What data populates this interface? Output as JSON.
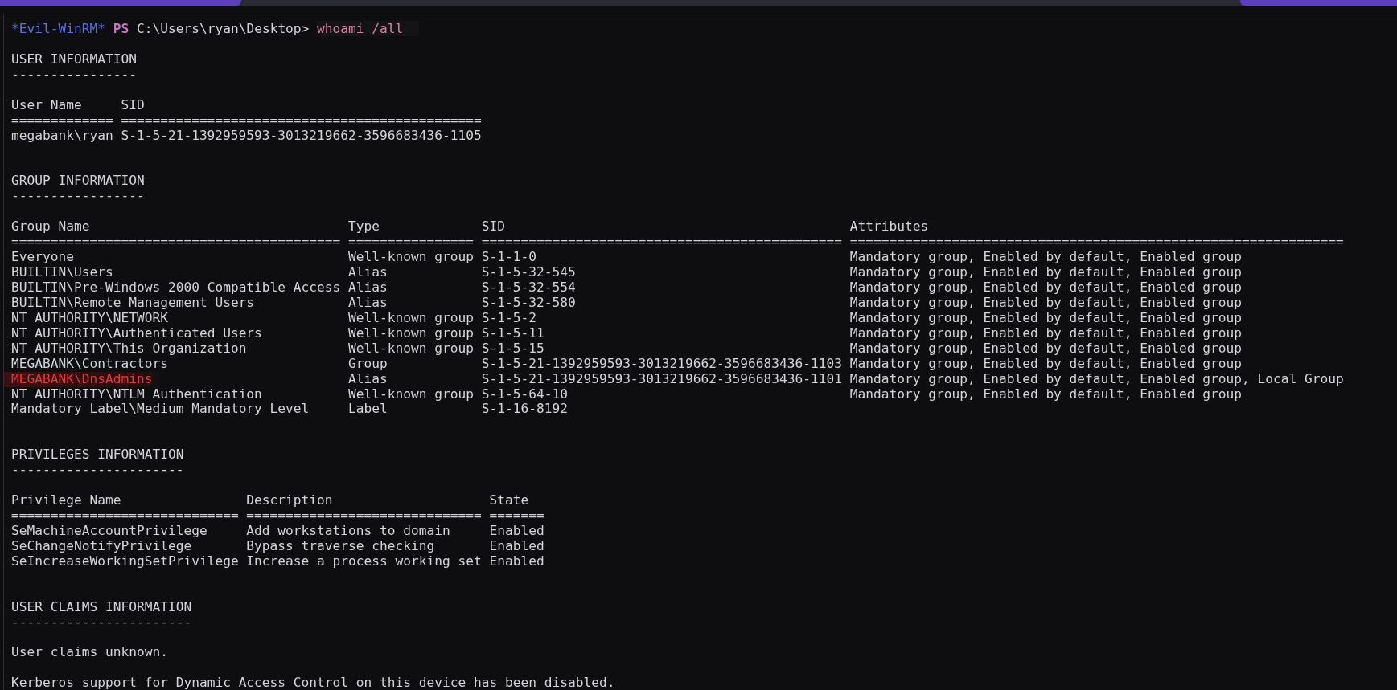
{
  "prompt": {
    "shell": "*Evil-WinRM*",
    "ps": "PS",
    "path": "C:\\Users\\ryan\\Desktop>",
    "command": "whoami /all"
  },
  "blocks": [
    {
      "kind": "blank"
    },
    {
      "kind": "heading",
      "title": "USER INFORMATION",
      "rule": "----------------"
    },
    {
      "kind": "blank"
    },
    {
      "kind": "table",
      "columns": [
        {
          "label": "User Name",
          "rule": "============="
        },
        {
          "label": "SID",
          "rule": "=============================================="
        }
      ],
      "rows": [
        {
          "cells": [
            "megabank\\ryan",
            "S-1-5-21-1392959593-3013219662-3596683436-1105"
          ],
          "highlighted": false
        }
      ]
    },
    {
      "kind": "blank"
    },
    {
      "kind": "blank"
    },
    {
      "kind": "heading",
      "title": "GROUP INFORMATION",
      "rule": "-----------------"
    },
    {
      "kind": "blank"
    },
    {
      "kind": "table",
      "columns": [
        {
          "label": "Group Name",
          "rule": "=========================================="
        },
        {
          "label": "Type",
          "rule": "================"
        },
        {
          "label": "SID",
          "rule": "=============================================="
        },
        {
          "label": "Attributes",
          "rule": "==============================================================="
        }
      ],
      "rows": [
        {
          "cells": [
            "Everyone",
            "Well-known group",
            "S-1-1-0",
            "Mandatory group, Enabled by default, Enabled group"
          ],
          "highlighted": false
        },
        {
          "cells": [
            "BUILTIN\\Users",
            "Alias",
            "S-1-5-32-545",
            "Mandatory group, Enabled by default, Enabled group"
          ],
          "highlighted": false
        },
        {
          "cells": [
            "BUILTIN\\Pre-Windows 2000 Compatible Access",
            "Alias",
            "S-1-5-32-554",
            "Mandatory group, Enabled by default, Enabled group"
          ],
          "highlighted": false
        },
        {
          "cells": [
            "BUILTIN\\Remote Management Users",
            "Alias",
            "S-1-5-32-580",
            "Mandatory group, Enabled by default, Enabled group"
          ],
          "highlighted": false
        },
        {
          "cells": [
            "NT AUTHORITY\\NETWORK",
            "Well-known group",
            "S-1-5-2",
            "Mandatory group, Enabled by default, Enabled group"
          ],
          "highlighted": false
        },
        {
          "cells": [
            "NT AUTHORITY\\Authenticated Users",
            "Well-known group",
            "S-1-5-11",
            "Mandatory group, Enabled by default, Enabled group"
          ],
          "highlighted": false
        },
        {
          "cells": [
            "NT AUTHORITY\\This Organization",
            "Well-known group",
            "S-1-5-15",
            "Mandatory group, Enabled by default, Enabled group"
          ],
          "highlighted": false
        },
        {
          "cells": [
            "MEGABANK\\Contractors",
            "Group",
            "S-1-5-21-1392959593-3013219662-3596683436-1103",
            "Mandatory group, Enabled by default, Enabled group"
          ],
          "highlighted": false
        },
        {
          "cells": [
            "MEGABANK\\DnsAdmins",
            "Alias",
            "S-1-5-21-1392959593-3013219662-3596683436-1101",
            "Mandatory group, Enabled by default, Enabled group, Local Group"
          ],
          "highlighted": true
        },
        {
          "cells": [
            "NT AUTHORITY\\NTLM Authentication",
            "Well-known group",
            "S-1-5-64-10",
            "Mandatory group, Enabled by default, Enabled group"
          ],
          "highlighted": false
        },
        {
          "cells": [
            "Mandatory Label\\Medium Mandatory Level",
            "Label",
            "S-1-16-8192"
          ],
          "highlighted": false
        }
      ]
    },
    {
      "kind": "blank"
    },
    {
      "kind": "blank"
    },
    {
      "kind": "heading",
      "title": "PRIVILEGES INFORMATION",
      "rule": "----------------------"
    },
    {
      "kind": "blank"
    },
    {
      "kind": "table",
      "columns": [
        {
          "label": "Privilege Name",
          "rule": "============================="
        },
        {
          "label": "Description",
          "rule": "=============================="
        },
        {
          "label": "State",
          "rule": "======="
        }
      ],
      "rows": [
        {
          "cells": [
            "SeMachineAccountPrivilege",
            "Add workstations to domain",
            "Enabled"
          ],
          "highlighted": false
        },
        {
          "cells": [
            "SeChangeNotifyPrivilege",
            "Bypass traverse checking",
            "Enabled"
          ],
          "highlighted": false
        },
        {
          "cells": [
            "SeIncreaseWorkingSetPrivilege",
            "Increase a process working set",
            "Enabled"
          ],
          "highlighted": false
        }
      ]
    },
    {
      "kind": "blank"
    },
    {
      "kind": "blank"
    },
    {
      "kind": "heading",
      "title": "USER CLAIMS INFORMATION",
      "rule": "-----------------------"
    },
    {
      "kind": "blank"
    },
    {
      "kind": "text",
      "text": "User claims unknown."
    },
    {
      "kind": "blank"
    },
    {
      "kind": "text",
      "text": "Kerberos support for Dynamic Access Control on this device has been disabled."
    }
  ]
}
